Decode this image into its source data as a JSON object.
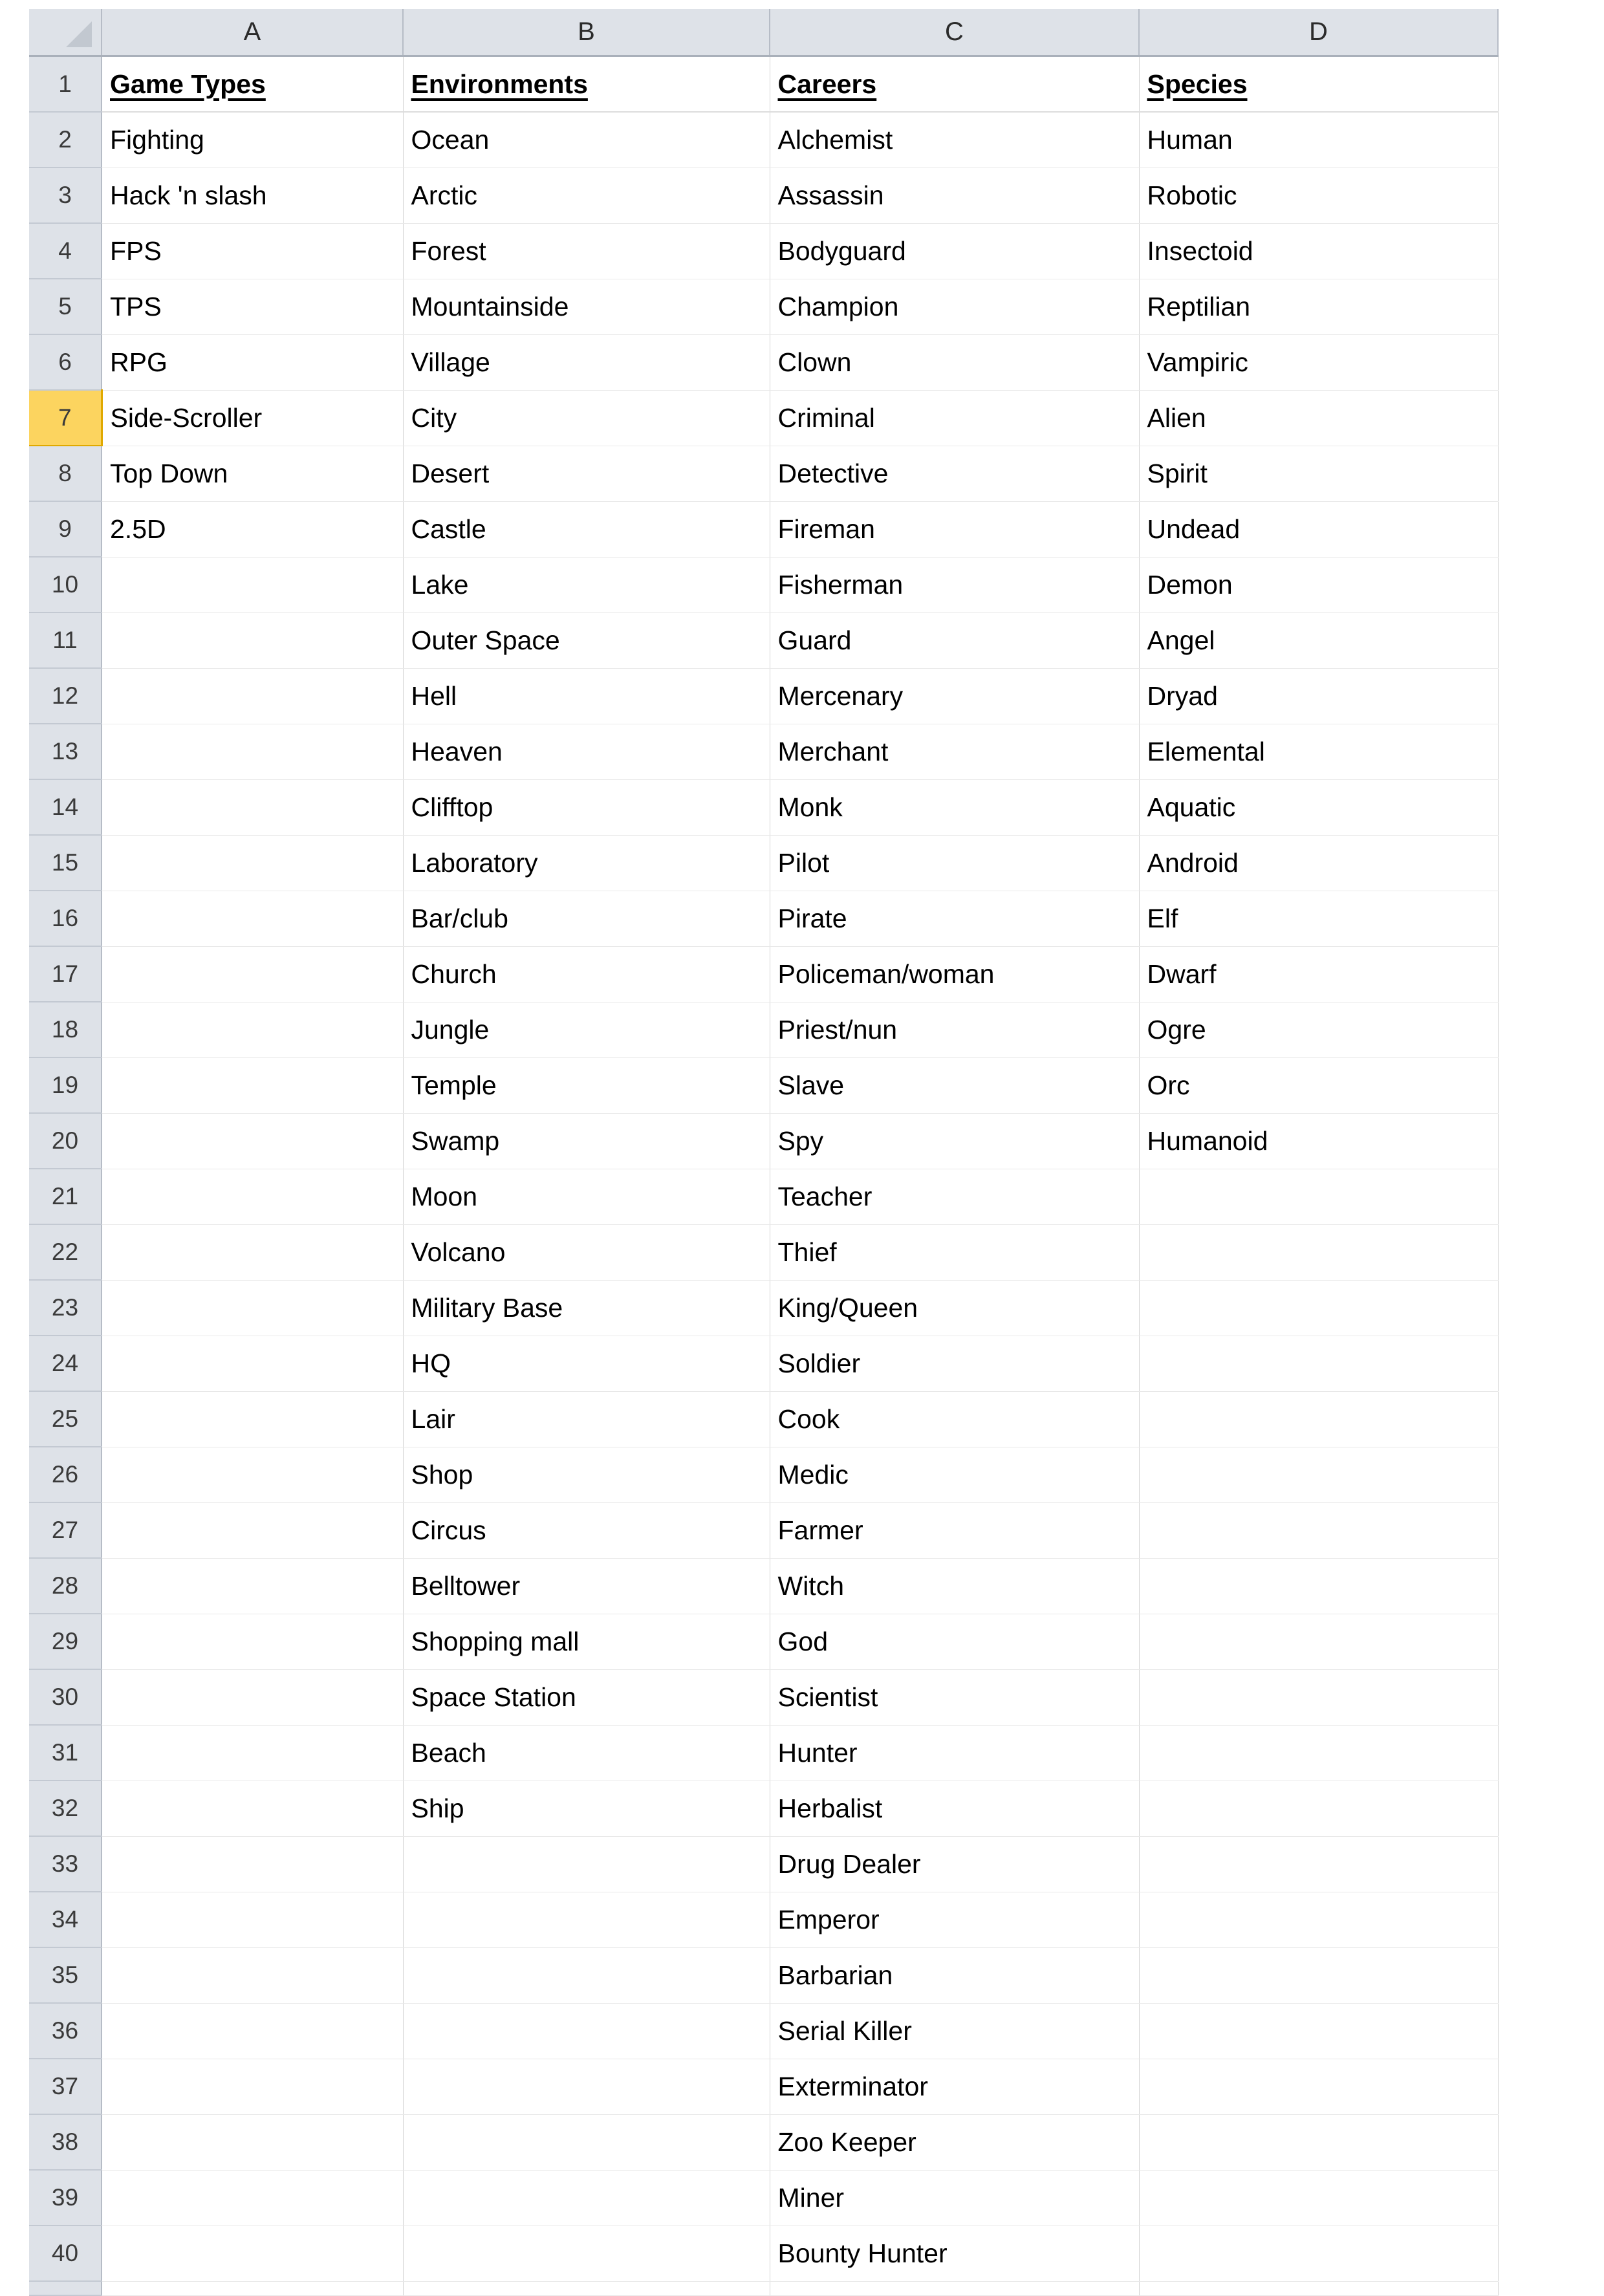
{
  "spreadsheet": {
    "select_all_icon": "select-all-triangle-icon",
    "column_headers": [
      "A",
      "B",
      "C",
      "D"
    ],
    "row_numbers": [
      "1",
      "2",
      "3",
      "4",
      "5",
      "6",
      "7",
      "8",
      "9",
      "10",
      "11",
      "12",
      "13",
      "14",
      "15",
      "16",
      "17",
      "18",
      "19",
      "20",
      "21",
      "22",
      "23",
      "24",
      "25",
      "26",
      "27",
      "28",
      "29",
      "30",
      "31",
      "32",
      "33",
      "34",
      "35",
      "36",
      "37",
      "38",
      "39",
      "40"
    ],
    "selected_row": "7",
    "selection_color": "#fcd45f",
    "header_background": "#dee2e8",
    "gridline_color": "#e8e8e8",
    "headers": {
      "a": "Game Types",
      "b": "Environments",
      "c": "Careers",
      "d": "Species"
    },
    "columns": {
      "game_types": [
        "Fighting",
        "Hack 'n slash",
        "FPS",
        "TPS",
        "RPG",
        "Side-Scroller",
        "Top Down",
        "2.5D",
        "",
        "",
        "",
        "",
        "",
        "",
        "",
        "",
        "",
        "",
        "",
        "",
        "",
        "",
        "",
        "",
        "",
        "",
        "",
        "",
        "",
        "",
        "",
        "",
        "",
        "",
        "",
        "",
        "",
        "",
        ""
      ],
      "environments": [
        "Ocean",
        "Arctic",
        "Forest",
        "Mountainside",
        "Village",
        "City",
        "Desert",
        "Castle",
        "Lake",
        "Outer Space",
        "Hell",
        "Heaven",
        "Clifftop",
        "Laboratory",
        "Bar/club",
        "Church",
        "Jungle",
        "Temple",
        "Swamp",
        "Moon",
        "Volcano",
        "Military Base",
        "HQ",
        "Lair",
        "Shop",
        "Circus",
        "Belltower",
        "Shopping mall",
        "Space Station",
        "Beach",
        "Ship",
        "",
        "",
        "",
        "",
        "",
        "",
        "",
        ""
      ],
      "careers": [
        "Alchemist",
        "Assassin",
        "Bodyguard",
        "Champion",
        "Clown",
        "Criminal",
        "Detective",
        "Fireman",
        "Fisherman",
        "Guard",
        "Mercenary",
        "Merchant",
        "Monk",
        "Pilot",
        "Pirate",
        "Policeman/woman",
        "Priest/nun",
        "Slave",
        "Spy",
        "Teacher",
        "Thief",
        "King/Queen",
        "Soldier",
        "Cook",
        "Medic",
        "Farmer",
        "Witch",
        "God",
        "Scientist",
        "Hunter",
        "Herbalist",
        "Drug Dealer",
        "Emperor",
        "Barbarian",
        "Serial Killer",
        "Exterminator",
        "Zoo Keeper",
        "Miner",
        "Bounty Hunter"
      ],
      "species": [
        "Human",
        "Robotic",
        "Insectoid",
        "Reptilian",
        "Vampiric",
        "Alien",
        "Spirit",
        "Undead",
        "Demon",
        "Angel",
        "Dryad",
        "Elemental",
        "Aquatic",
        "Android",
        "Elf",
        "Dwarf",
        "Ogre",
        "Orc",
        "Humanoid",
        "",
        "",
        "",
        "",
        "",
        "",
        "",
        "",
        "",
        "",
        "",
        "",
        "",
        "",
        "",
        "",
        "",
        "",
        "",
        ""
      ]
    }
  }
}
